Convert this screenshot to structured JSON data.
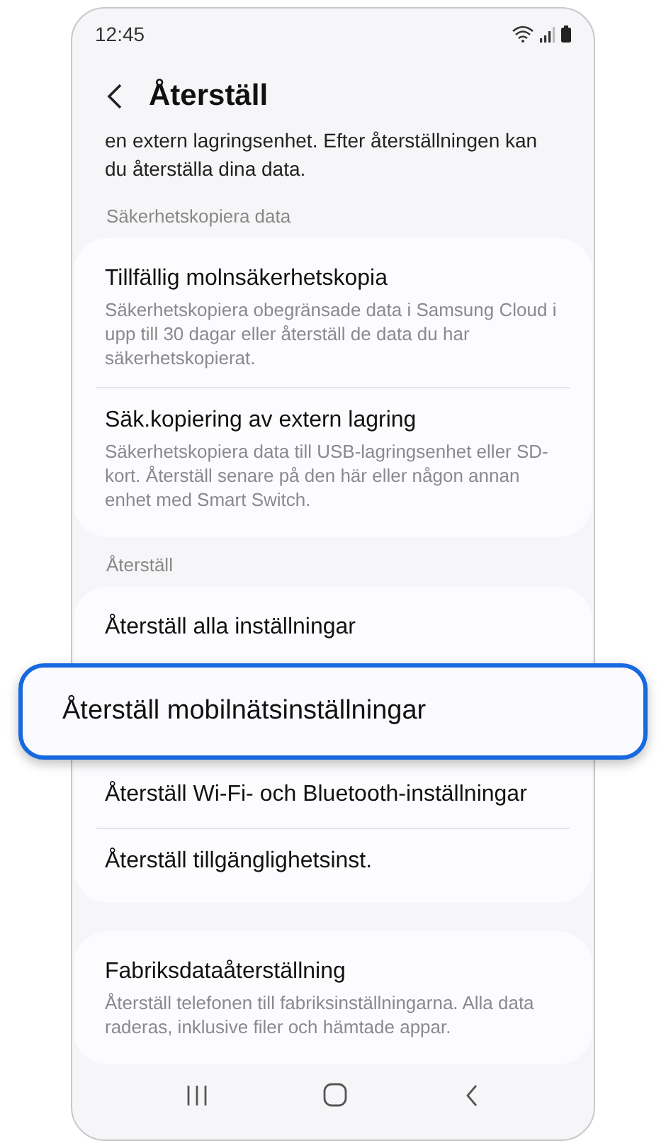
{
  "status_bar": {
    "time": "12:45"
  },
  "header": {
    "title": "Återställ"
  },
  "intro": "en extern lagringsenhet. Efter återställningen kan du återställa dina data.",
  "sections": [
    {
      "title": "Säkerhetskopiera data",
      "items": [
        {
          "kind": "item",
          "title": "Tillfällig molnsäkerhetskopia",
          "subtitle": "Säkerhetskopiera obegränsade data i Samsung Cloud i upp till 30 dagar eller återställ de data du har säkerhetskopierat."
        },
        {
          "kind": "item",
          "title": "Säk.kopiering av extern lagring",
          "subtitle": "Säkerhetskopiera data till USB-lagringsenhet eller SD-kort. Återställ senare på den här eller någon annan enhet med Smart Switch."
        }
      ]
    },
    {
      "title": "Återställ",
      "items": [
        {
          "kind": "item",
          "title": "Återställ alla inställningar"
        },
        {
          "kind": "callout",
          "title": "Återställ mobilnätsinställningar"
        },
        {
          "kind": "item",
          "title": "Återställ Wi-Fi- och Bluetooth-inställningar"
        },
        {
          "kind": "item",
          "title": "Återställ tillgänglighetsinst."
        }
      ]
    },
    {
      "items": [
        {
          "kind": "item",
          "title": "Fabriksdataåterställning",
          "subtitle": "Återställ telefonen till fabriksinställningarna. Alla data raderas, inklusive filer och hämtade appar."
        }
      ]
    }
  ]
}
